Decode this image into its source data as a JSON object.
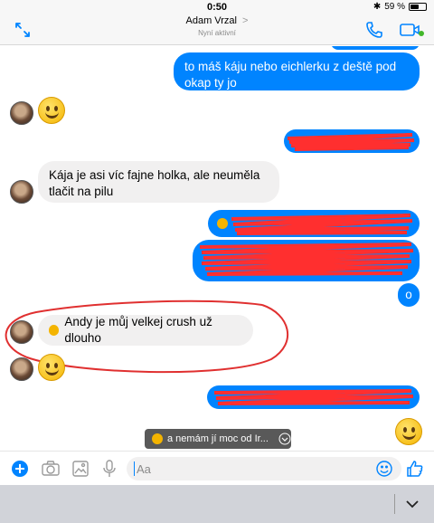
{
  "status_bar": {
    "time": "0:50",
    "battery": "59 %",
    "battery_level": 0.59
  },
  "header": {
    "contact_name": "Adam Vrzal",
    "chevron": ">",
    "contact_status": "Nyní aktivní"
  },
  "messages": [
    {
      "from": "me",
      "text": "to máš káju nebo eichlerku z deště pod okap ty jo"
    },
    {
      "from": "them",
      "text": "Kája je asi víc fajne holka, ale neuměla tlačit na pilu"
    },
    {
      "from": "me",
      "text": "o"
    },
    {
      "from": "them",
      "text": "Andy je můj velkej crush už dlouho"
    }
  ],
  "suggestion": {
    "text": "a nemám jí moc od Ir..."
  },
  "composer": {
    "placeholder": "Aa"
  },
  "colors": {
    "accent": "#0084ff",
    "incoming_bubble": "#f1f0f0",
    "annotation": "#e03030"
  }
}
